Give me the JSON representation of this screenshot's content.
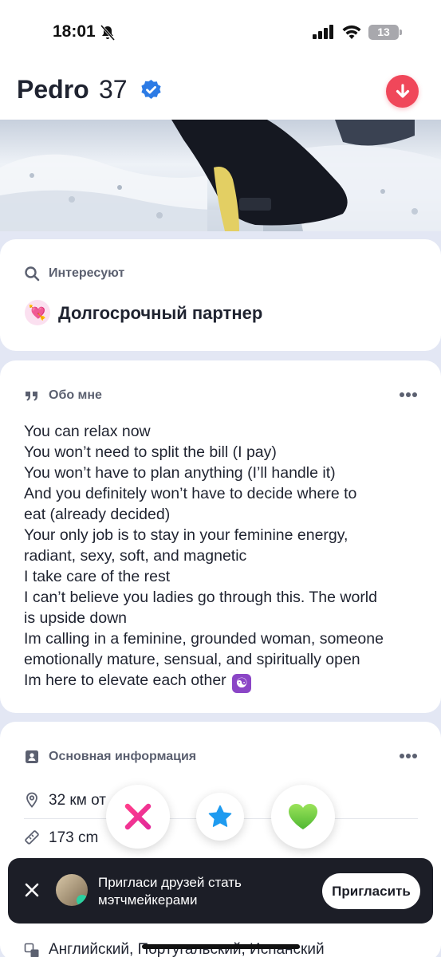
{
  "status_bar": {
    "time": "18:01",
    "battery": "13"
  },
  "header": {
    "name": "Pedro",
    "age": "37"
  },
  "interests": {
    "title": "Интересуют",
    "value": "Долгосрочный партнер",
    "emoji": "💘"
  },
  "about": {
    "title": "Обо мне",
    "lines": [
      "You can relax now",
      "You won’t need to split the bill (I pay)",
      "You won’t have to plan anything (I’ll handle it)",
      "And you definitely won’t have to decide where to",
      "eat (already decided)",
      "Your only job is to stay in your feminine energy,",
      "radiant, sexy, soft, and magnetic",
      "I take care of the rest",
      "I can’t believe you ladies go through this. The world",
      "is upside down",
      "Im calling in a feminine, grounded woman, someone",
      "emotionally mature, sensual, and spiritually open",
      "Im here to elevate each other"
    ],
    "last_emoji": "☯"
  },
  "basic_info": {
    "title": "Основная информация",
    "distance": "32 км от",
    "height": "173 cm",
    "languages": "Английский, Португальский, Испанский"
  },
  "invite": {
    "text": "Пригласи друзей стать мэтчмейкерами",
    "button": "Пригласить"
  },
  "colors": {
    "accent_red": "#f0475a",
    "verified_blue": "#2c7be5",
    "pass_pink": "#ff3d8b",
    "star_blue": "#1e9bf0",
    "like_green": "#7ed321"
  }
}
